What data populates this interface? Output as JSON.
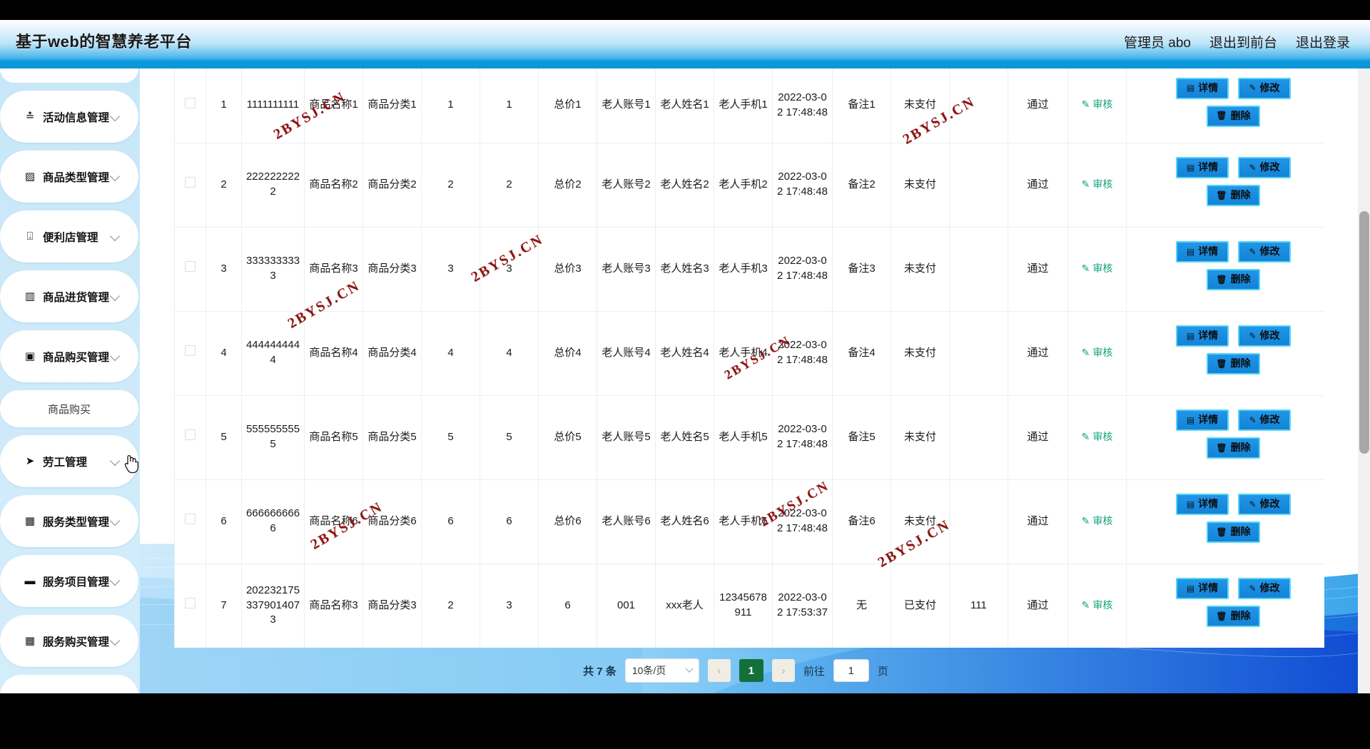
{
  "header": {
    "brand": "基于web的智慧养老平台",
    "user_label": "管理员 abo",
    "exit_front_label": "退出到前台",
    "logout_label": "退出登录"
  },
  "sidebar": {
    "items": [
      {
        "label": "活动信息管理",
        "icon": "sliders-icon",
        "glyph": "≛",
        "type": "group"
      },
      {
        "label": "商品类型管理",
        "icon": "ticket-icon",
        "glyph": "▨",
        "type": "group"
      },
      {
        "label": "便利店管理",
        "icon": "shop-icon",
        "glyph": "⍗",
        "type": "group"
      },
      {
        "label": "商品进货管理",
        "icon": "bars-icon",
        "glyph": "▥",
        "type": "group"
      },
      {
        "label": "商品购买管理",
        "icon": "clipboard-icon",
        "glyph": "▣",
        "type": "group"
      },
      {
        "label": "商品购买",
        "icon": "",
        "glyph": "",
        "type": "sub"
      },
      {
        "label": "劳工管理",
        "icon": "send-icon",
        "glyph": "➤",
        "type": "group"
      },
      {
        "label": "服务类型管理",
        "icon": "grid-icon",
        "glyph": "▦",
        "type": "group"
      },
      {
        "label": "服务项目管理",
        "icon": "monitor-icon",
        "glyph": "▬",
        "type": "group"
      },
      {
        "label": "服务购买管理",
        "icon": "grid-icon",
        "glyph": "▦",
        "type": "group"
      }
    ]
  },
  "table": {
    "rows": [
      {
        "index": "1",
        "order_no": "1111111111",
        "goods_name": "商品名称1",
        "goods_type": "商品分类1",
        "price": "1",
        "qty": "1",
        "total": "总价1",
        "elder_account": "老人账号1",
        "elder_name": "老人姓名1",
        "elder_phone": "老人手机1",
        "time": "2022-03-02 17:48:48",
        "remark": "备注1",
        "pay_state": "未支付",
        "extra": "",
        "audit_state": "通过",
        "audit_link": "审核"
      },
      {
        "index": "2",
        "order_no": "2222222222",
        "goods_name": "商品名称2",
        "goods_type": "商品分类2",
        "price": "2",
        "qty": "2",
        "total": "总价2",
        "elder_account": "老人账号2",
        "elder_name": "老人姓名2",
        "elder_phone": "老人手机2",
        "time": "2022-03-02 17:48:48",
        "remark": "备注2",
        "pay_state": "未支付",
        "extra": "",
        "audit_state": "通过",
        "audit_link": "审核"
      },
      {
        "index": "3",
        "order_no": "3333333333",
        "goods_name": "商品名称3",
        "goods_type": "商品分类3",
        "price": "3",
        "qty": "3",
        "total": "总价3",
        "elder_account": "老人账号3",
        "elder_name": "老人姓名3",
        "elder_phone": "老人手机3",
        "time": "2022-03-02 17:48:48",
        "remark": "备注3",
        "pay_state": "未支付",
        "extra": "",
        "audit_state": "通过",
        "audit_link": "审核"
      },
      {
        "index": "4",
        "order_no": "4444444444",
        "goods_name": "商品名称4",
        "goods_type": "商品分类4",
        "price": "4",
        "qty": "4",
        "total": "总价4",
        "elder_account": "老人账号4",
        "elder_name": "老人姓名4",
        "elder_phone": "老人手机4",
        "time": "2022-03-02 17:48:48",
        "remark": "备注4",
        "pay_state": "未支付",
        "extra": "",
        "audit_state": "通过",
        "audit_link": "审核"
      },
      {
        "index": "5",
        "order_no": "5555555555",
        "goods_name": "商品名称5",
        "goods_type": "商品分类5",
        "price": "5",
        "qty": "5",
        "total": "总价5",
        "elder_account": "老人账号5",
        "elder_name": "老人姓名5",
        "elder_phone": "老人手机5",
        "time": "2022-03-02 17:48:48",
        "remark": "备注5",
        "pay_state": "未支付",
        "extra": "",
        "audit_state": "通过",
        "audit_link": "审核"
      },
      {
        "index": "6",
        "order_no": "6666666666",
        "goods_name": "商品名称6",
        "goods_type": "商品分类6",
        "price": "6",
        "qty": "6",
        "total": "总价6",
        "elder_account": "老人账号6",
        "elder_name": "老人姓名6",
        "elder_phone": "老人手机6",
        "time": "2022-03-02 17:48:48",
        "remark": "备注6",
        "pay_state": "未支付",
        "extra": "",
        "audit_state": "通过",
        "audit_link": "审核"
      },
      {
        "index": "7",
        "order_no": "2022321753379014073",
        "goods_name": "商品名称3",
        "goods_type": "商品分类3",
        "price": "2",
        "qty": "3",
        "total": "6",
        "elder_account": "001",
        "elder_name": "xxx老人",
        "elder_phone": "12345678911",
        "time": "2022-03-02 17:53:37",
        "remark": "无",
        "pay_state": "已支付",
        "extra": "111",
        "audit_state": "通过",
        "audit_link": "审核"
      }
    ],
    "ops": {
      "detail_label": "详情",
      "edit_label": "修改",
      "delete_label": "删除",
      "detail_icon": "document-icon",
      "edit_icon": "pencil-icon",
      "delete_icon": "trash-icon",
      "audit_icon": "pencil-icon"
    }
  },
  "pagination": {
    "total_label": "共 7 条",
    "page_size": "10条/页",
    "prev_glyph": "‹",
    "next_glyph": "›",
    "current_page": "1",
    "goto_label": "前往",
    "goto_value": "1",
    "page_unit": "页"
  },
  "watermark": {
    "text": "2BYSJ.CN"
  },
  "colors": {
    "brand_blue": "#0a9ae0",
    "button_blue": "#1383d6",
    "button_border": "#57d4f5",
    "audit_teal": "#13a37f",
    "page_active_green": "#13703a",
    "watermark_red": "#8c1512"
  }
}
